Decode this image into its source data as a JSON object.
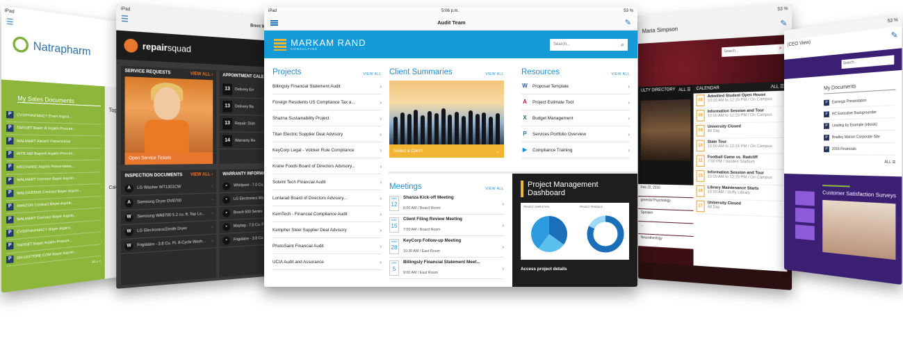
{
  "natrapharm": {
    "status": "iPad",
    "brand": "Natrapharm",
    "section_title": "My Sales Documents",
    "side_title": "Top D",
    "side_label": "Calen",
    "docs": [
      "CVS/PHARMACY Event Aspira...",
      "TARGET Bayer B Aspirin Procure...",
      "WALMART Aleve® Presentation",
      "RITE AID Bayer® Aspirin Procure...",
      "MECHANIC Aspirin Presentation...",
      "WALMART Contract Bayer Aspirin...",
      "WALGREENS Contract Bayer Aspirin...",
      "AMAZON Contract Bayer Aspirin...",
      "WALMART Contract Bayer Aspirin...",
      "CVS/PHARMACY Bayer Aspirin...",
      "TARGET Bayer Aspirin Procure...",
      "DRUGSTORE.COM Bayer Aspirin..."
    ],
    "all": "ALL »"
  },
  "repair": {
    "status": "iPad",
    "user": "Brent McC",
    "brand_a": "repair",
    "brand_b": "squad",
    "service_title": "SERVICE REQUESTS",
    "view_all": "VIEW ALL ›",
    "open_tickets": "Open Service Tickets",
    "appt_title": "APPOINTMENT CALEN",
    "appts": [
      {
        "m": "MAR",
        "d": "13",
        "t": "Delivery Eri"
      },
      {
        "m": "MAR",
        "d": "13",
        "t": "Delivery Ba"
      },
      {
        "m": "MAR",
        "d": "13",
        "t": "Repair: Dish"
      },
      {
        "m": "MAR",
        "d": "14",
        "t": "Warranty Re"
      }
    ],
    "insp_title": "INSPECTION DOCUMENTS",
    "insp_view": "VIEW ALL ›",
    "insp": [
      {
        "ic": "A",
        "t": "LG Washer WT1301CW"
      },
      {
        "ic": "A",
        "t": "Samsung Dryer DV8700"
      },
      {
        "ic": "W",
        "t": "Samsung WA8700 5.2 cu. ft. Top Lo..."
      },
      {
        "ic": "W",
        "t": "LG Electronics/Zenith Dryer"
      },
      {
        "ic": "W",
        "t": "Frigidaire - 3.8 Cu. Ft. 8-Cycle Wash..."
      }
    ],
    "warranty_title": "WARRANTY INFORMA",
    "warranty": [
      "Whirlpool - 7.0 Cu.",
      "LG Electronics Wa",
      "Bosch 500 Series",
      "Maytag - 7.0 Cu. F",
      "Frigidaire - 3.8 Cu."
    ]
  },
  "main": {
    "status_left": "iPad",
    "status_time": "5:06 p.m.",
    "status_right": "53 %",
    "nav_title": "Audit Team",
    "logo_main": "MARKAM RAND",
    "logo_sub": "CONSULTING",
    "search_placeholder": "Search...",
    "view_all": "VIEW ALL",
    "projects_title": "Projects",
    "projects": [
      "Billingsly Financial Statement Audit",
      "Foreign Residents US Compliance Tax a...",
      "Shazna Sustainability Project",
      "Titan Electric Supplier Deal Advisory",
      "KeyCorp Legal - Volcker Rule Compliance",
      "Krane Foods Board of Directors Advisory...",
      "Solvint Tech Financial Audit",
      "Lorilarad Board of Directors Advisory...",
      "KemTech - Financial Compliance Audit",
      "Kempher Steel Supplier Deal Advisory",
      "PhotoSaint Financial Audit",
      "UCIA Audit and Assurance"
    ],
    "clients_title": "Client Summaries",
    "select_client": "Select a Client",
    "resources_title": "Resources",
    "resources": [
      {
        "icon": "W",
        "label": "Proposal Template"
      },
      {
        "icon": "A",
        "label": "Project Estimate Tool"
      },
      {
        "icon": "X",
        "label": "Budget Management"
      },
      {
        "icon": "P",
        "label": "Services Portfolio Overview"
      },
      {
        "icon": "▶",
        "label": "Compliance Training"
      }
    ],
    "meetings_title": "Meetings",
    "meetings": [
      {
        "m": "MAR",
        "d": "12",
        "title": "Shanza Kick-off Meeting",
        "sub": "8:00 AM / Board Room"
      },
      {
        "m": "MAR",
        "d": "15",
        "title": "Client Filing Review Meeting",
        "sub": "7:00 AM / Board Room"
      },
      {
        "m": "MAR",
        "d": "28",
        "title": "KeyCorp Follow-up Meeting",
        "sub": "10:30 AM / East Room"
      },
      {
        "m": "APR",
        "d": "5",
        "title": "Billingsly Financial Statement Meet...",
        "sub": "9:00 AM / East Room"
      }
    ],
    "pmd_title_1": "Project Management",
    "pmd_title_2": "Dashboard",
    "pmd_panel_1": "PROJECT COMPLETION",
    "pmd_panel_2": "PROJECT FEEDBACK",
    "pmd_pie_values": [
      0.35,
      0.25,
      0.4
    ],
    "pmd_donut_value": 0.82,
    "access": "Access project details"
  },
  "univ": {
    "status": "53 %",
    "user": "Maria Simpson",
    "search_placeholder": "Search...",
    "dir_label": "ULTY DIRECTORY",
    "all": "ALL ☰",
    "cal_label": "CALENDAR",
    "events": [
      {
        "m": "APR",
        "d": "08",
        "t": "Admitted Student Open House",
        "s": "10:00 AM to 12:15 PM / On Campus"
      },
      {
        "m": "APR",
        "d": "08",
        "t": "Information Session and Tour",
        "s": "10:00 AM to 12:15 PM / On Campus"
      },
      {
        "m": "APR",
        "d": "09",
        "t": "University Closed",
        "s": "All Day"
      },
      {
        "m": "APR",
        "d": "10",
        "t": "State Tour",
        "s": "10:00 AM to 12:15 PM / On Campus"
      },
      {
        "m": "APR",
        "d": "11",
        "t": "Football Game vs. Radcliff",
        "s": "7:00 PM / Vanden Stadium"
      },
      {
        "m": "APR",
        "d": "15",
        "t": "Information Session and Tour",
        "s": "10:00 AM to 12:15 PM / On Campus"
      },
      {
        "m": "APR",
        "d": "16",
        "t": "Library Maintenance Starts",
        "s": "10:00 AM / Duffy Library"
      },
      {
        "m": "APR",
        "d": "17",
        "t": "University Closed",
        "s": "All Day"
      }
    ],
    "lower": [
      "Feb 22, 2016",
      "gmental Psychology",
      "Speaker",
      "...",
      "Neurotheology"
    ]
  },
  "cust": {
    "status": "53 %",
    "hdr": "(CEO View)",
    "search_placeholder": "Search...",
    "docs_title": "My Documents",
    "docs": [
      "Earnings Presentation",
      "HC Executive Backgrounder",
      "Leading by Example (ebook)",
      "Bradley Marion Corporate Site",
      "2016 Financials"
    ],
    "all": "ALL ☰",
    "survey_title": "Customer Satisfaction Surveys"
  }
}
